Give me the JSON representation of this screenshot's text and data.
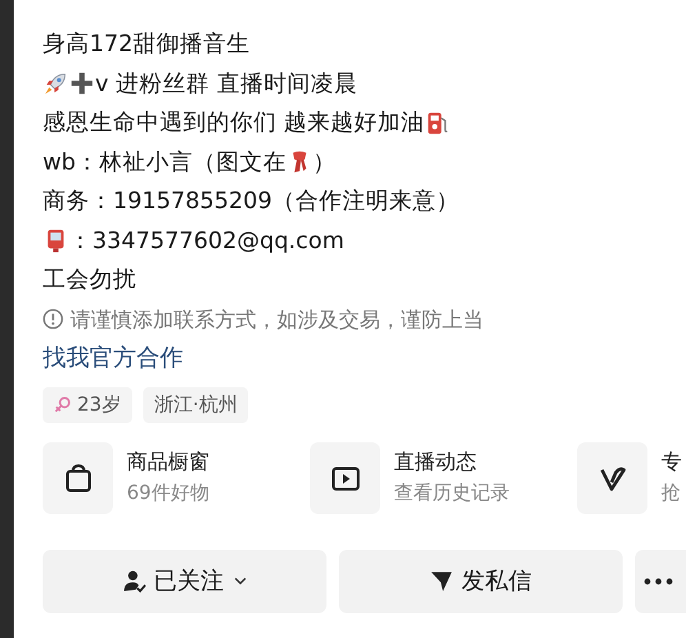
{
  "bio": [
    {
      "kind": "plain",
      "text": "身高172甜御播音生"
    },
    {
      "kind": "rocket_plus",
      "text": "v 进粉丝群  直播时间凌晨"
    },
    {
      "kind": "fuel_after",
      "text": "感恩生命中遇到的你们 越来越好加油"
    },
    {
      "kind": "scarf_inside",
      "text": "wb：林祉小言（图文在",
      "after": "）"
    },
    {
      "kind": "plain",
      "text": "商务：19157855209（合作注明来意）"
    },
    {
      "kind": "mail_before",
      "text": "：3347577602@qq.com"
    },
    {
      "kind": "plain",
      "text": "工会勿扰"
    }
  ],
  "notice": "请谨慎添加联系方式，如涉及交易，谨防上当",
  "official_link": "找我官方合作",
  "tags": [
    {
      "kind": "female",
      "text": "23岁"
    },
    {
      "kind": "plain",
      "text": "浙江·杭州"
    }
  ],
  "cards": [
    {
      "kind": "shop",
      "title": "商品橱窗",
      "subtitle": "69件好物"
    },
    {
      "kind": "live",
      "title": "直播动态",
      "subtitle": "查看历史记录"
    },
    {
      "kind": "v",
      "title": "专",
      "subtitle": "抢"
    }
  ],
  "actions": [
    {
      "kind": "followed",
      "label": "已关注"
    },
    {
      "kind": "message",
      "label": "发私信"
    },
    {
      "kind": "more"
    }
  ]
}
